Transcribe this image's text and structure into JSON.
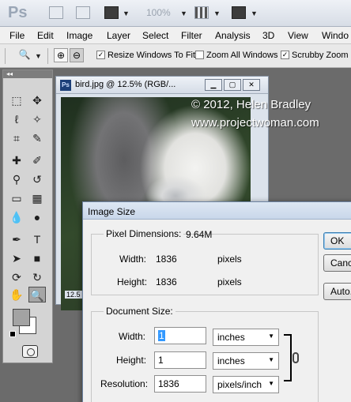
{
  "appbar": {
    "logo": "Ps",
    "zoom": "100%",
    "icons": [
      "bridge-icon",
      "mini-bridge-icon",
      "view-extras-icon",
      "zoom-level-icon",
      "arrange-documents-icon",
      "screen-mode-icon"
    ]
  },
  "menu": [
    "File",
    "Edit",
    "Image",
    "Layer",
    "Select",
    "Filter",
    "Analysis",
    "3D",
    "View",
    "Windo"
  ],
  "options": {
    "resize_windows": {
      "label": "Resize Windows To Fit",
      "checked": true
    },
    "zoom_all": {
      "label": "Zoom All Windows",
      "checked": false
    },
    "scrubby_zoom": {
      "label": "Scrubby Zoom",
      "checked": true
    }
  },
  "document": {
    "title": "bird.jpg @ 12.5% (RGB/...",
    "zoom_status": "12.5"
  },
  "watermark": {
    "line1": "© 2012, Helen Bradley",
    "line2": "www.projectwoman.com"
  },
  "dialog": {
    "title": "Image Size",
    "pixel_dimensions": {
      "label": "Pixel Dimensions:",
      "value": "9.64M",
      "width_label": "Width:",
      "width_value": "1836",
      "width_unit": "pixels",
      "height_label": "Height:",
      "height_value": "1836",
      "height_unit": "pixels"
    },
    "document_size": {
      "label": "Document Size:",
      "width_label": "Width:",
      "width_value": "1",
      "width_unit": "inches",
      "height_label": "Height:",
      "height_value": "1",
      "height_unit": "inches",
      "resolution_label": "Resolution:",
      "resolution_value": "1836",
      "resolution_unit": "pixels/inch"
    },
    "buttons": {
      "ok": "OK",
      "cancel": "Cancel",
      "auto": "Auto..."
    }
  },
  "colors": {
    "foreground": "#a3a3a3",
    "background": "#ffffff"
  }
}
